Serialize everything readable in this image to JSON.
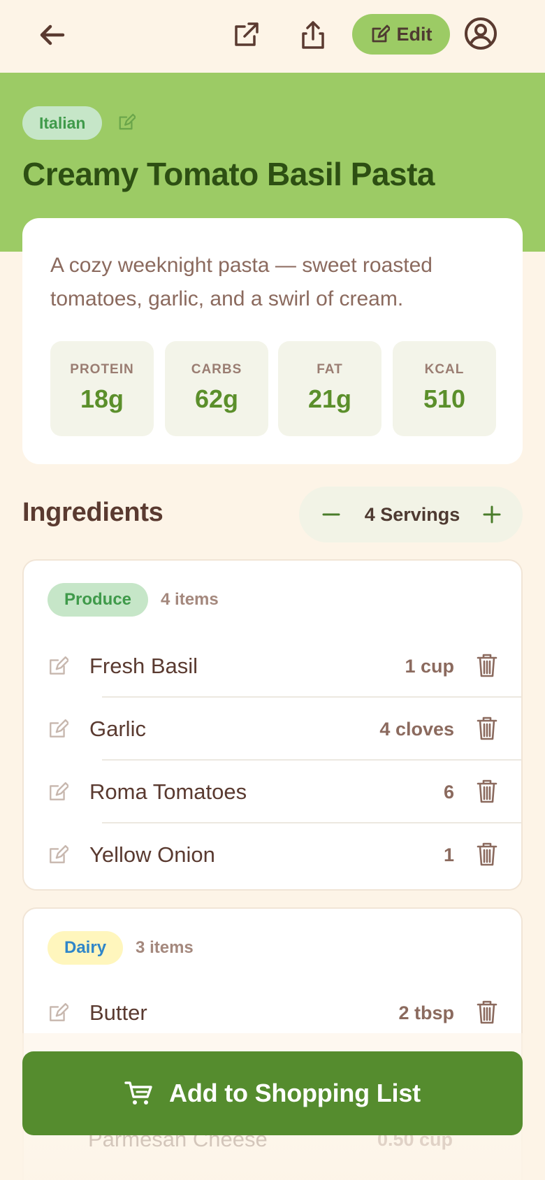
{
  "header": {
    "back_icon": "arrow-left-icon",
    "open_icon": "external-link-icon",
    "share_icon": "share-icon",
    "edit_label": "Edit",
    "account_icon": "user-circle-icon"
  },
  "recipe": {
    "cuisine": "Italian",
    "title": "Creamy Tomato Basil Pasta",
    "description": "A cozy weeknight pasta — sweet roasted tomatoes, garlic, and a swirl of cream."
  },
  "macros": [
    {
      "label": "PROTEIN",
      "value": "18g"
    },
    {
      "label": "CARBS",
      "value": "62g"
    },
    {
      "label": "FAT",
      "value": "21g"
    },
    {
      "label": "KCAL",
      "value": "510"
    }
  ],
  "ingredients": {
    "heading": "Ingredients",
    "servings_label": "4 Servings",
    "groups": [
      {
        "name": "Produce",
        "count": "4 items",
        "items": [
          {
            "name": "Fresh Basil",
            "qty": "1 cup"
          },
          {
            "name": "Garlic",
            "qty": "4 cloves"
          },
          {
            "name": "Roma Tomatoes",
            "qty": "6"
          },
          {
            "name": "Yellow Onion",
            "qty": "1"
          }
        ]
      },
      {
        "name": "Dairy",
        "count": "3 items",
        "items": [
          {
            "name": "Butter",
            "qty": "2 tbsp"
          },
          {
            "name": "Parmesan Cheese",
            "qty": "0.50 cup"
          }
        ]
      }
    ]
  },
  "cta": {
    "label": "Add to Shopping List"
  },
  "colors": {
    "background": "#fdf4e7",
    "hero": "#9ccb65",
    "title": "#2d4f13",
    "cta": "#558c2e",
    "macro_value": "#5b8f2b",
    "produce_tag_bg": "#c6e6c8",
    "produce_tag_fg": "#3f9a4a",
    "dairy_tag_bg": "#fff6bd",
    "dairy_tag_fg": "#2f86c9"
  }
}
